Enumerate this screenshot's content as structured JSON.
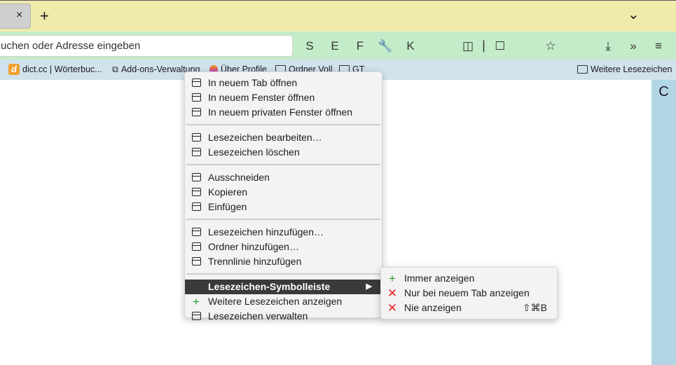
{
  "tabbar": {
    "close": "×",
    "new_tab": "+",
    "list_tabs": "⌄"
  },
  "nav": {
    "url_placeholder": "uchen oder Adresse eingeben",
    "buttons": [
      "S",
      "E",
      "F",
      "🔧",
      "K"
    ],
    "sidebar_toggle": "◫",
    "sidebar2": "⎸☐",
    "bookmark_star": "☆",
    "download": "⤓",
    "overflow": "»",
    "menu": "≡"
  },
  "bookmarks": [
    {
      "label": "dict.cc | Wörterbuc...",
      "icon": "d"
    },
    {
      "label": "Add-ons-Verwaltung"
    },
    {
      "label": "Über Profile"
    },
    {
      "label": "Ordner Voll"
    },
    {
      "label": "GT"
    }
  ],
  "more_bookmarks": "Weitere Lesezeichen",
  "sidebar_letter": "C",
  "context_menu": {
    "groups": [
      [
        "In neuem Tab öffnen",
        "In neuem Fenster öffnen",
        "In neuem privaten Fenster öffnen"
      ],
      [
        "Lesezeichen bearbeiten…",
        "Lesezeichen löschen"
      ],
      [
        "Ausschneiden",
        "Kopieren",
        "Einfügen"
      ],
      [
        "Lesezeichen hinzufügen…",
        "Ordner hinzufügen…",
        "Trennlinie hinzufügen"
      ]
    ],
    "toolbar_item": "Lesezeichen-Symbolleiste",
    "more": "Weitere Lesezeichen anzeigen",
    "manage": "Lesezeichen verwalten"
  },
  "submenu": {
    "items": [
      "Immer anzeigen",
      "Nur bei neuem Tab anzeigen",
      "Nie anzeigen"
    ],
    "shortcut": "⇧⌘B"
  },
  "colors": {
    "plus": "#2a9a2a",
    "x": "#e22"
  }
}
